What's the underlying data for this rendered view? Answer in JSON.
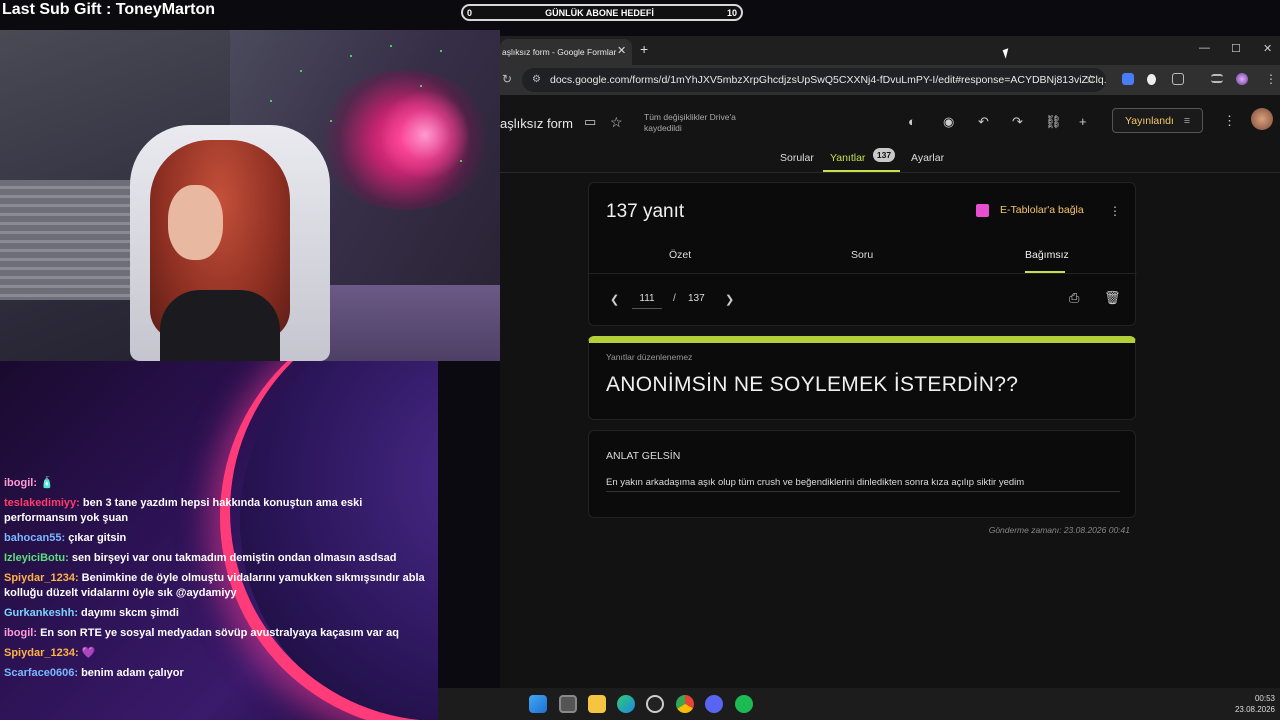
{
  "overlay": {
    "sub_gift": "Last Sub Gift : ToneyMarton",
    "goal": {
      "min": "0",
      "label": "GÜNLÜK ABONE HEDEFİ",
      "max": "10"
    }
  },
  "chat": [
    {
      "user": "ibogil",
      "user_color": "#ff9bd6",
      "text": "🧴"
    },
    {
      "user": "teslakedimiyy",
      "user_color": "#ff3b6b",
      "text": "ben 3 tane yazdım hepsi hakkında konuştun ama eski performansım yok şuan"
    },
    {
      "user": "bahocan55",
      "user_color": "#7ab8ff",
      "text": "çıkar gitsin"
    },
    {
      "user": "IzleyiciBotu",
      "user_color": "#5ce07a",
      "text": "sen birşeyi var onu takmadım demiştin ondan olmasın asdsad"
    },
    {
      "user": "Spiydar_1234",
      "user_color": "#ffb347",
      "text": "Benimkine de öyle olmuştu vidalarını yamukken sıkmışsındır abla kolluğu düzelt vidalarını öyle sık @aydamiyy"
    },
    {
      "user": "Gurkankeshh",
      "user_color": "#7dd3ff",
      "text": "dayımı skcm şimdi"
    },
    {
      "user": "ibogil",
      "user_color": "#ff9bd6",
      "text": "En son RTE ye sosyal medyadan sövüp avustralyaya kaçasım var aq"
    },
    {
      "user": "Spiydar_1234",
      "user_color": "#ffb347",
      "text": "💜"
    },
    {
      "user": "Scarface0606",
      "user_color": "#7ab8ff",
      "text": "benim adam çalıyor"
    }
  ],
  "browser": {
    "tab_title": "aşlıksız form - Google Formlar",
    "tab_close": "✕",
    "new_tab": "+",
    "url": "docs.google.com/forms/d/1mYhJXV5mbzXrpGhcdjzsUpSwQ5CXXNj4-fDvuLmPY-I/edit#response=ACYDBNj813viZClq...",
    "window_controls": [
      "—",
      "☐",
      "✕"
    ]
  },
  "form_header": {
    "title": "aşlıksız form",
    "saved_text": "Tüm değişiklikler Drive'a kaydedildi",
    "publish_label": "Yayınlandı",
    "tabs": [
      "Sorular",
      "Yanıtlar",
      "Ayarlar"
    ],
    "response_badge": "137"
  },
  "responses": {
    "count_title": "137 yanıt",
    "sheets_link": "E-Tablolar'a bağla",
    "subtabs": [
      "Özet",
      "Soru",
      "Bağımsız"
    ],
    "current_page": "111",
    "separator": "/",
    "total": "137"
  },
  "form_card": {
    "notice": "Yanıtlar düzenlenemez",
    "title": "ANONİMSİN NE SOYLEMEK İSTERDİN??"
  },
  "question": {
    "label": "ANLAT GELSİN",
    "answer": "En yakın arkadaşıma aşık olup tüm crush ve beğendiklerini dinledikten sonra kıza açılıp siktir yedim"
  },
  "submitted": "Gönderme zamanı: 23.08.2026 00:41",
  "taskbar": {
    "time": "00:53",
    "date": "23.08.2026",
    "icons": [
      "windows-icon",
      "task-view-icon",
      "file-explorer-icon",
      "edge-icon",
      "app-icon",
      "chrome-icon",
      "discord-icon",
      "spotify-icon"
    ]
  }
}
